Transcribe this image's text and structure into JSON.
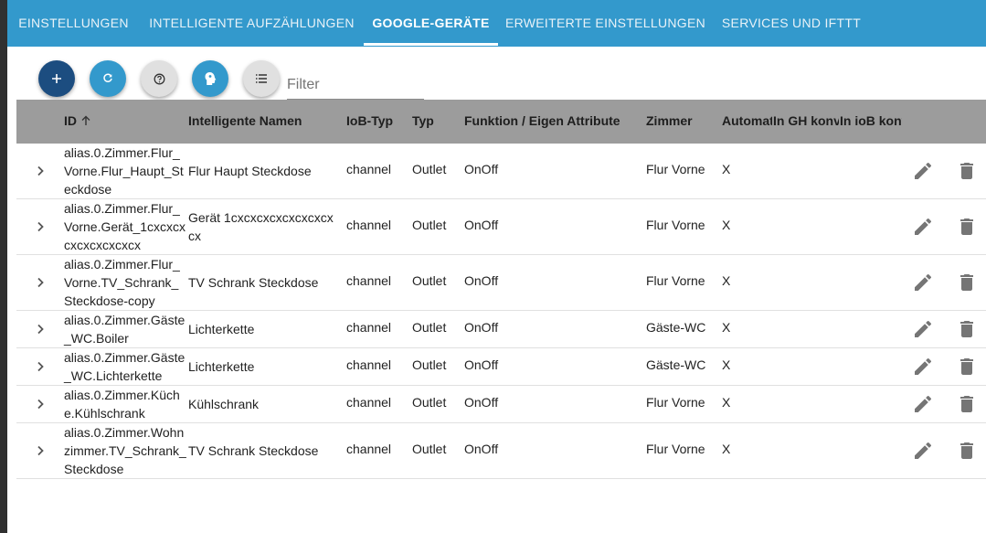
{
  "tabs": [
    {
      "label": "Einstellungen"
    },
    {
      "label": "Intelligente Aufzählungen"
    },
    {
      "label": "Google-Geräte"
    },
    {
      "label": "Erweiterte Einstellungen"
    },
    {
      "label": "Services und IFTTT"
    }
  ],
  "active_tab": "Google-Geräte",
  "toolbar": {
    "buttons": [
      {
        "icon": "plus-icon",
        "color": "#1c4d80"
      },
      {
        "icon": "refresh-icon",
        "color": "#3399cc"
      },
      {
        "icon": "help-icon",
        "color": "#e0e0e0"
      },
      {
        "icon": "head-icon",
        "color": "#3399cc"
      },
      {
        "icon": "list-icon",
        "color": "#e0e0e0"
      }
    ],
    "filter_placeholder": "Filter"
  },
  "table": {
    "columns": [
      "ID",
      "Intelligente Namen",
      "IoB-Typ",
      "Typ",
      "Funktion / Eigen Attribute",
      "Zimmer",
      "Automat",
      "In GH konv",
      "In ioB konv"
    ],
    "rows": [
      {
        "id": "alias.0.Zimmer.Flur_Vorne.Flur_Haupt_Steckdose",
        "name": "Flur Haupt Steckdose",
        "iob_type": "channel",
        "type": "Outlet",
        "function": "OnOff",
        "room": "Flur Vorne",
        "auto": "X"
      },
      {
        "id": "alias.0.Zimmer.Flur_Vorne.Gerät_1cxcxcxcxcxcxcxcxcx",
        "name": "Gerät 1cxcxcxcxcxcxcxcxcx",
        "iob_type": "channel",
        "type": "Outlet",
        "function": "OnOff",
        "room": "Flur Vorne",
        "auto": "X"
      },
      {
        "id": "alias.0.Zimmer.Flur_Vorne.TV_Schrank_Steckdose-copy",
        "name": "TV Schrank Steckdose",
        "iob_type": "channel",
        "type": "Outlet",
        "function": "OnOff",
        "room": "Flur Vorne",
        "auto": "X"
      },
      {
        "id": "alias.0.Zimmer.Gäste_WC.Boiler",
        "name": "Lichterkette",
        "iob_type": "channel",
        "type": "Outlet",
        "function": "OnOff",
        "room": "Gäste-WC",
        "auto": "X"
      },
      {
        "id": "alias.0.Zimmer.Gäste_WC.Lichterkette",
        "name": "Lichterkette",
        "iob_type": "channel",
        "type": "Outlet",
        "function": "OnOff",
        "room": "Gäste-WC",
        "auto": "X"
      },
      {
        "id": "alias.0.Zimmer.Küche.Kühlschrank",
        "name": "Kühlschrank",
        "iob_type": "channel",
        "type": "Outlet",
        "function": "OnOff",
        "room": "Flur Vorne",
        "auto": "X"
      },
      {
        "id": "alias.0.Zimmer.Wohnzimmer.TV_Schrank_Steckdose",
        "name": "TV Schrank Steckdose",
        "iob_type": "channel",
        "type": "Outlet",
        "function": "OnOff",
        "room": "Flur Vorne",
        "auto": "X"
      }
    ]
  },
  "colors": {
    "tabbar": "#3399cc",
    "table_header": "#9c9c9c",
    "icon_grey": "#757575"
  }
}
